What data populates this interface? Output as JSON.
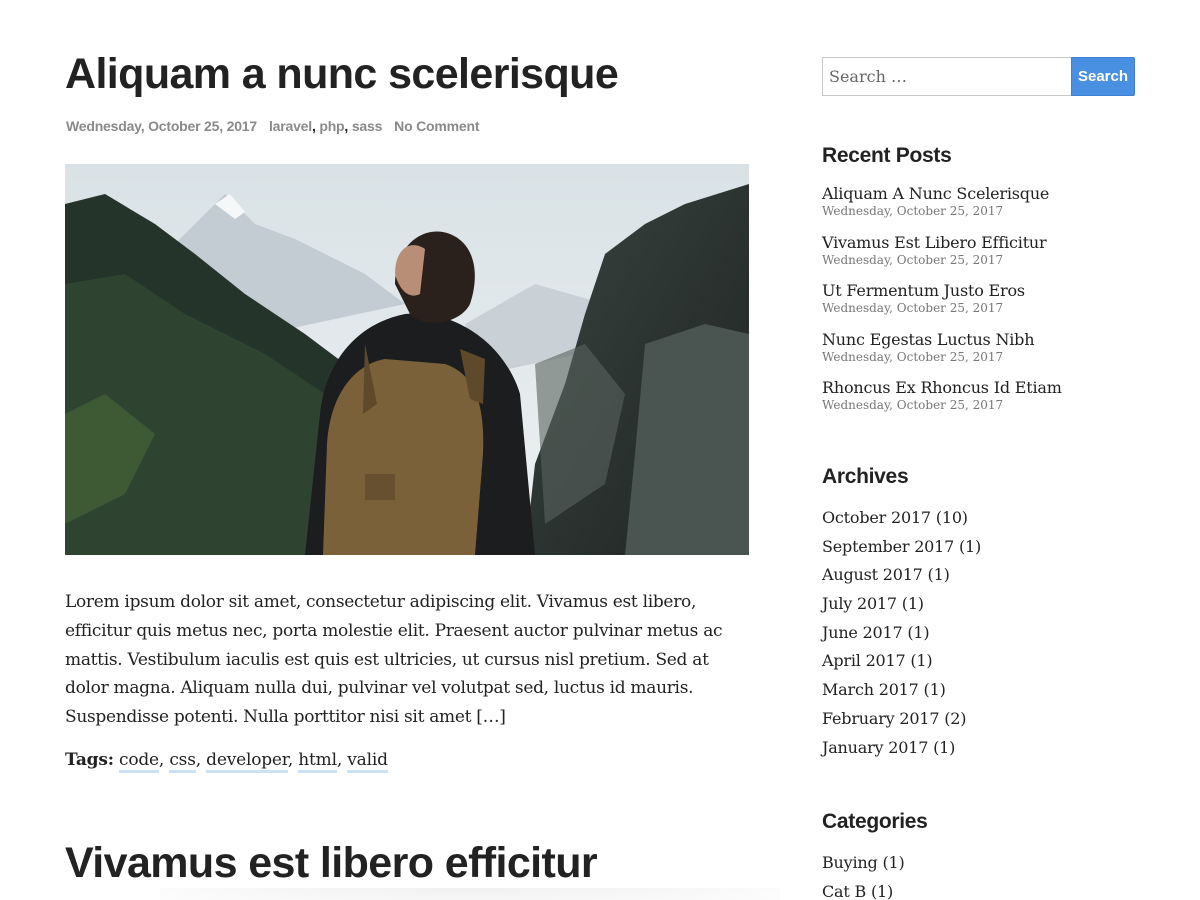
{
  "posts": [
    {
      "title": "Aliquam a nunc scelerisque",
      "date": "Wednesday, October 25, 2017",
      "categories": [
        "laravel",
        "php",
        "sass"
      ],
      "comments": "No Comment",
      "excerpt": "Lorem ipsum dolor sit amet, consectetur adipiscing elit. Vivamus est libero, efficitur quis metus nec, porta molestie elit. Praesent auctor pulvinar metus ac mattis. Vestibulum iaculis est quis est ultricies, ut cursus nisl pretium. Sed at dolor magna. Aliquam nulla dui, pulvinar vel volutpat sed, luctus id mauris. Suspendisse potenti. Nulla porttitor nisi sit amet […]",
      "tags_label": "Tags:",
      "tags": [
        "code",
        "css",
        "developer",
        "html",
        "valid"
      ]
    },
    {
      "title": "Vivamus est libero efficitur"
    }
  ],
  "separator": ",",
  "sidebar": {
    "search": {
      "placeholder": "Search …",
      "button_label": "Search"
    },
    "recent_posts": {
      "title": "Recent Posts",
      "items": [
        {
          "title": "Aliquam A Nunc Scelerisque",
          "date": "Wednesday, October 25, 2017"
        },
        {
          "title": "Vivamus Est Libero Efficitur",
          "date": "Wednesday, October 25, 2017"
        },
        {
          "title": "Ut Fermentum Justo Eros",
          "date": "Wednesday, October 25, 2017"
        },
        {
          "title": "Nunc Egestas Luctus Nibh",
          "date": "Wednesday, October 25, 2017"
        },
        {
          "title": "Rhoncus Ex Rhoncus Id Etiam",
          "date": "Wednesday, October 25, 2017"
        }
      ]
    },
    "archives": {
      "title": "Archives",
      "items": [
        {
          "label": "October 2017",
          "count": "(10)"
        },
        {
          "label": "September 2017",
          "count": "(1)"
        },
        {
          "label": "August 2017",
          "count": "(1)"
        },
        {
          "label": "July 2017",
          "count": "(1)"
        },
        {
          "label": "June 2017",
          "count": "(1)"
        },
        {
          "label": "April 2017",
          "count": "(1)"
        },
        {
          "label": "March 2017",
          "count": "(1)"
        },
        {
          "label": "February 2017",
          "count": "(2)"
        },
        {
          "label": "January 2017",
          "count": "(1)"
        }
      ]
    },
    "categories": {
      "title": "Categories",
      "items": [
        {
          "label": "Buying",
          "count": "(1)"
        },
        {
          "label": "Cat B",
          "count": "(1)"
        }
      ]
    }
  },
  "colors": {
    "text": "#222222",
    "meta": "#8a8a8a",
    "accent": "#4a90e2",
    "tag_underline": "#c9e2f5"
  }
}
